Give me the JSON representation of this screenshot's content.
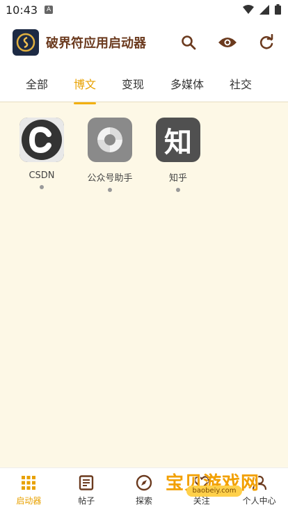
{
  "status": {
    "time": "10:43",
    "indicator": "A"
  },
  "header": {
    "title": "破界符应用启动器",
    "icons": [
      "search-icon",
      "eye-icon",
      "refresh-icon"
    ]
  },
  "tabs": [
    {
      "label": "全部",
      "active": false
    },
    {
      "label": "博文",
      "active": true
    },
    {
      "label": "变现",
      "active": false
    },
    {
      "label": "多媒体",
      "active": false
    },
    {
      "label": "社交",
      "active": false
    }
  ],
  "apps": [
    {
      "label": "CSDN",
      "icon": "csdn-icon"
    },
    {
      "label": "公众号助手",
      "icon": "wechat-mp-icon"
    },
    {
      "label": "知乎",
      "icon": "zhihu-icon",
      "glyph": "知"
    }
  ],
  "nav": [
    {
      "label": "启动器",
      "icon": "grid-icon",
      "active": true
    },
    {
      "label": "帖子",
      "icon": "document-icon",
      "active": false
    },
    {
      "label": "探索",
      "icon": "compass-icon",
      "active": false
    },
    {
      "label": "关注",
      "icon": "heart-icon",
      "active": false
    },
    {
      "label": "个人中心",
      "icon": "person-icon",
      "active": false
    }
  ],
  "watermark": {
    "text": "宝贝游戏网",
    "url": "baobeiy.com"
  },
  "colors": {
    "accent": "#e8a100",
    "title": "#6b3a1e",
    "background": "#fdf8e6"
  }
}
